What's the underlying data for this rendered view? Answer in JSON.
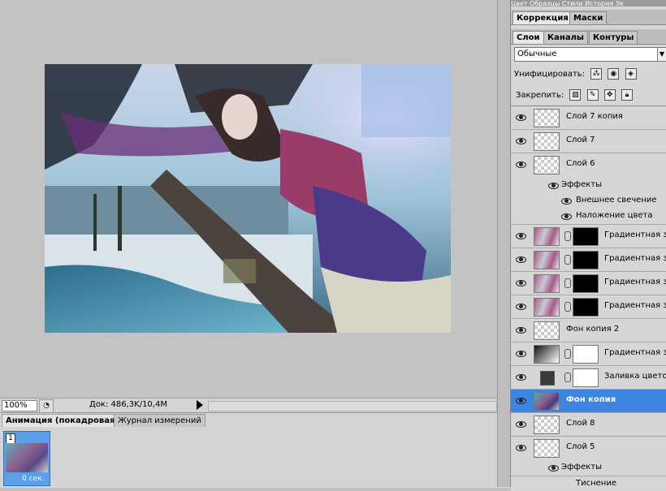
{
  "top_tabs": "Цвет  Образцы  Стили  История  Эк",
  "correction_panel": {
    "tabs": [
      "Коррекция",
      "Маски"
    ]
  },
  "layers_panel": {
    "tabs": [
      "Слои",
      "Каналы",
      "Контуры"
    ],
    "blend_mode": "Обычные",
    "unify_label": "Унифицировать:",
    "lock_label": "Закрепить:",
    "layers": [
      {
        "name": "Слой 7 копия",
        "thumb": "transparent"
      },
      {
        "name": "Слой 7",
        "thumb": "transparent"
      },
      {
        "name": "Слой 6",
        "thumb": "transparent"
      },
      {
        "name": "Эффекты",
        "type": "effects"
      },
      {
        "name": "Внешнее свечение",
        "type": "effect"
      },
      {
        "name": "Наложение цвета",
        "type": "effect"
      },
      {
        "name": "Градиентная зал",
        "thumb": "pink",
        "mask": "black"
      },
      {
        "name": "Градиентная зал",
        "thumb": "pink",
        "mask": "black"
      },
      {
        "name": "Градиентная зал",
        "thumb": "pink",
        "mask": "black"
      },
      {
        "name": "Градиентная зал",
        "thumb": "pink",
        "mask": "black"
      },
      {
        "name": "Фон копия 2",
        "thumb": "transparent"
      },
      {
        "name": "Градиентная зал",
        "thumb": "grad",
        "mask": "white"
      },
      {
        "name": "Заливка цветом",
        "thumb": "dark",
        "mask": "white"
      },
      {
        "name": "Фон копия",
        "thumb": "photo",
        "selected": true
      },
      {
        "name": "Слой 8",
        "thumb": "transparent"
      },
      {
        "name": "Слой 5",
        "thumb": "transparent"
      },
      {
        "name": "Эффекты",
        "type": "effects"
      },
      {
        "name": "Тиснение",
        "type": "effect"
      }
    ]
  },
  "status_bar": {
    "zoom": "100%",
    "doc_info": "Док: 486,3K/10,4M"
  },
  "animation_panel": {
    "tabs": [
      "Анимация (покадровая)",
      "Журнал измерений"
    ],
    "frame": {
      "number": "1",
      "time": "0 сек."
    }
  }
}
